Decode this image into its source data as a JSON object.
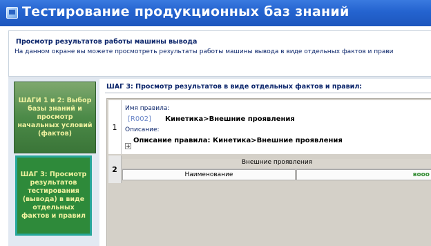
{
  "window": {
    "title": "Тестирование продукционных баз знаний"
  },
  "info": {
    "title": "Просмотр результатов работы машины вывода",
    "description": "На данном окране вы можете просмотреть результаты работы машины вывода в виде отдельных фактов и прави"
  },
  "sidebar": {
    "steps": [
      {
        "label": "ШАГИ 1 и 2: Выбор базы знаний и просмотр начальных условий (фактов)"
      },
      {
        "label": "ШАГ 3: Просмотр результатов тестирования (вывода) в виде отдельных фактов и правил"
      }
    ]
  },
  "main": {
    "step_title": "ШАГ 3: Просмотр результатов в виде отдельных фактов и правил:",
    "rows": [
      {
        "num": "1",
        "rule_name_label": "Имя правила:",
        "rule_id": "[R002]",
        "rule_name": "Кинетика>Внешние проявления",
        "description_label": "Описание:",
        "description_text": "Описание правила: Кинетика>Внешние проявления"
      },
      {
        "num": "2",
        "sub_title": "Внешние проявления",
        "col_name": "Наименование",
        "col_value": "вооо"
      }
    ]
  },
  "colors": {
    "title_bar": "#2463cf",
    "sidebar_step": "#4c8a48",
    "sidebar_active_border": "#27a79a",
    "step_text": "#f0f2a0",
    "heading_text": "#0a246a"
  }
}
